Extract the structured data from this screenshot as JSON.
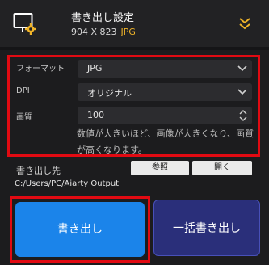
{
  "header": {
    "title": "書き出し設定",
    "dimensions": "904 X 823",
    "format": "JPG",
    "icon": "monitor-gear-icon",
    "collapse_icon": "double-chevron-down-icon",
    "accent": "#f0b429"
  },
  "settings": {
    "format": {
      "label": "フォーマット",
      "value": "JPG"
    },
    "dpi": {
      "label": "DPI",
      "value": "オリジナル"
    },
    "quality": {
      "label": "画質",
      "value": "100"
    },
    "note": "数値が大きいほど、画像が大きくなり、画質が高くなります。"
  },
  "output": {
    "label": "書き出し先",
    "browse_label": "参照",
    "open_label": "開く",
    "path": "C:/Users/PC/Aiarty Output"
  },
  "actions": {
    "export_label": "書き出し",
    "batch_export_label": "一括書き出し"
  },
  "colors": {
    "highlight": "#e10a12",
    "export_blue": "#1b84ea",
    "batch_navy": "#2a2f7a"
  }
}
